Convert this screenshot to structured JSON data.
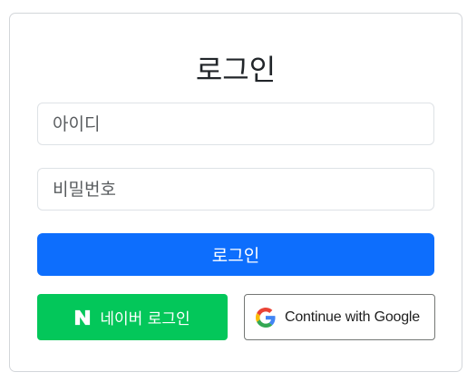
{
  "login_card": {
    "title": "로그인",
    "id_field": {
      "placeholder": "아이디",
      "value": ""
    },
    "password_field": {
      "placeholder": "비밀번호",
      "value": ""
    },
    "login_button": {
      "label": "로그인",
      "color": "#0d6efd"
    },
    "naver_button": {
      "label": "네이버 로그인",
      "icon": "naver-n-icon",
      "color": "#03c75a"
    },
    "google_button": {
      "label": "Continue with Google",
      "icon": "google-g-icon"
    }
  }
}
